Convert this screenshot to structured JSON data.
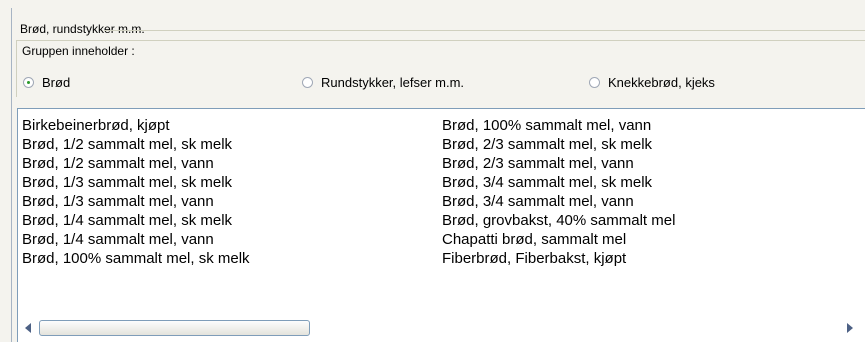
{
  "group": {
    "title": "Brød, rundstykker m.m.",
    "inner_title": "Gruppen inneholder :"
  },
  "radios": [
    {
      "label": "Brød",
      "checked": true
    },
    {
      "label": "Rundstykker, lefser m.m.",
      "checked": false
    },
    {
      "label": "Knekkebrød, kjeks",
      "checked": false
    }
  ],
  "list": {
    "column1": [
      "Birkebeinerbrød, kjøpt",
      "Brød, 1/2 sammalt mel, sk melk",
      "Brød, 1/2 sammalt mel, vann",
      "Brød, 1/3 sammalt mel, sk melk",
      "Brød, 1/3 sammalt mel, vann",
      "Brød, 1/4 sammalt mel, sk melk",
      "Brød, 1/4 sammalt mel, vann",
      "Brød, 100% sammalt mel, sk melk"
    ],
    "column2": [
      "Brød, 100% sammalt mel, vann",
      "Brød, 2/3 sammalt mel, sk melk",
      "Brød, 2/3 sammalt mel, vann",
      "Brød, 3/4 sammalt mel, sk melk",
      "Brød, 3/4 sammalt mel, vann",
      "Brød, grovbakst, 40% sammalt mel",
      "Chapatti brød, sammalt mel",
      "Fiberbrød, Fiberbakst, kjøpt"
    ]
  },
  "scrollbar": {
    "thumb_position_fraction": 0.0
  }
}
